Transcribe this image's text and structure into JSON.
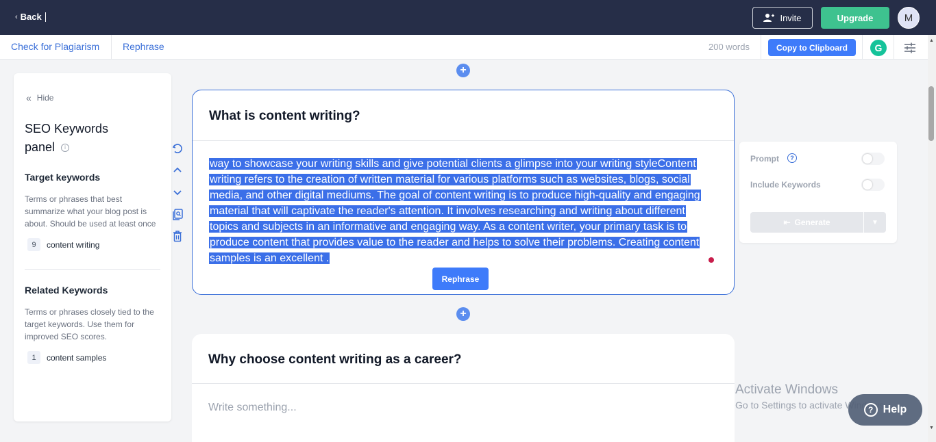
{
  "topbar": {
    "back_label": "Back",
    "invite_label": "Invite",
    "upgrade_label": "Upgrade",
    "avatar_initial": "M"
  },
  "subbar": {
    "plagiarism_label": "Check for Plagiarism",
    "rephrase_label": "Rephrase",
    "word_count": "200 words",
    "copy_label": "Copy to Clipboard",
    "grammarly_letter": "G"
  },
  "seo_panel": {
    "hide_label": "Hide",
    "title": "SEO Keywords panel",
    "target": {
      "title": "Target keywords",
      "description": "Terms or phrases that best summarize what your blog post is about. Should be used at least once",
      "keywords": [
        {
          "count": "9",
          "term": "content writing"
        }
      ]
    },
    "related": {
      "title": "Related Keywords",
      "description": "Terms or phrases closely tied to the target keywords. Use them for improved SEO scores.",
      "keywords": [
        {
          "count": "1",
          "term": "content samples"
        }
      ]
    }
  },
  "sections": [
    {
      "heading": "What is content writing?",
      "body": "way to showcase your writing skills and give potential clients a glimpse into your writing styleContent writing refers to the creation of written material for various platforms such as websites, blogs, social media, and other digital mediums. The goal of content writing is to produce high-quality and engaging material that will captivate the reader's attention. It involves researching and writing about different topics and subjects in an informative and engaging way. As a content writer, your primary task is to produce content that provides value to the reader and helps to solve their problems. Creating content samples is an excellent .",
      "rephrase_label": "Rephrase"
    },
    {
      "heading": "Why choose content writing as a career?",
      "placeholder": "Write something..."
    }
  ],
  "prompt_panel": {
    "prompt_label": "Prompt",
    "keywords_label": "Include Keywords",
    "generate_label": "Generate"
  },
  "activate_windows": {
    "title": "Activate Windows",
    "subtitle": "Go to Settings to activate Windows."
  },
  "help_label": "Help",
  "colors": {
    "topbar": "#262e48",
    "accent": "#3e7bfa",
    "upgrade": "#3ec28f",
    "selection": "#3b6fe8"
  }
}
